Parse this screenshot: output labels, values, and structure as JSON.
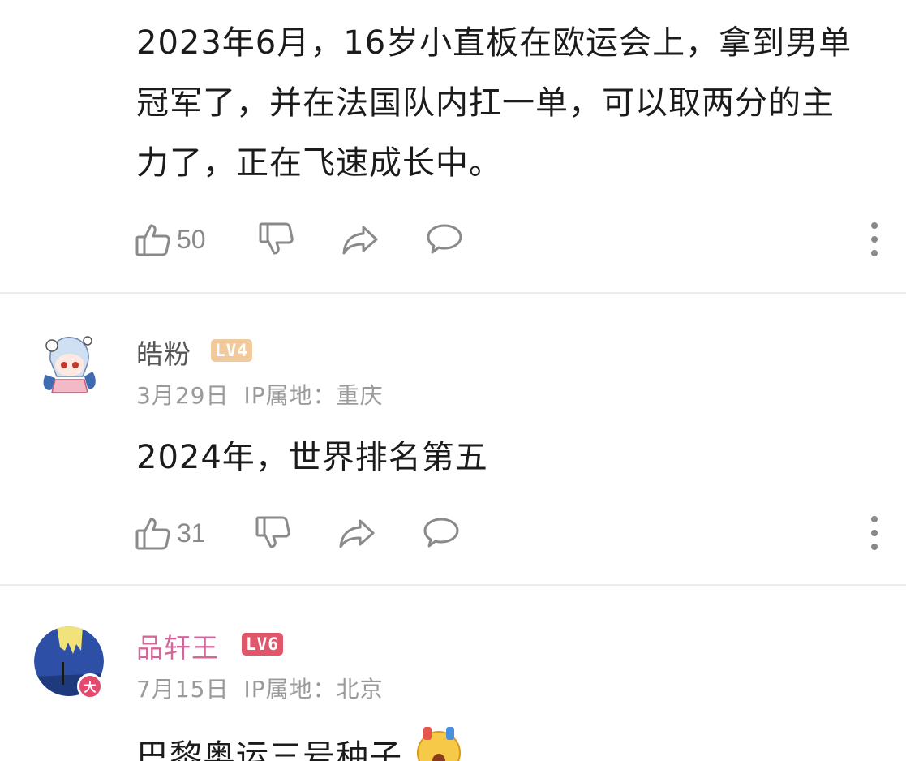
{
  "comments": [
    {
      "text": "2023年6月，16岁小直板在欧运会上，拿到男单冠军了，并在法国队内扛一单，可以取两分的主力了，正在飞速成长中。",
      "likes": "50"
    },
    {
      "user": "皓粉",
      "level": "LV4",
      "level_color": "#f2c99a",
      "date": "3月29日",
      "ip": "IP属地：重庆",
      "text": "2024年，世界排名第五",
      "likes": "31"
    },
    {
      "user": "品轩王",
      "user_color": "#d4679a",
      "level": "LV6",
      "level_color": "#e0566a",
      "date": "7月15日",
      "ip": "IP属地：北京",
      "text": "巴黎奥运三号种子"
    }
  ],
  "icons": [
    "thumbs-up-icon",
    "thumbs-down-icon",
    "share-icon",
    "comment-icon",
    "more-icon"
  ],
  "colors": {
    "icon": "#8a8a8a",
    "meta": "#9a9a9a",
    "divider": "#ececec"
  }
}
